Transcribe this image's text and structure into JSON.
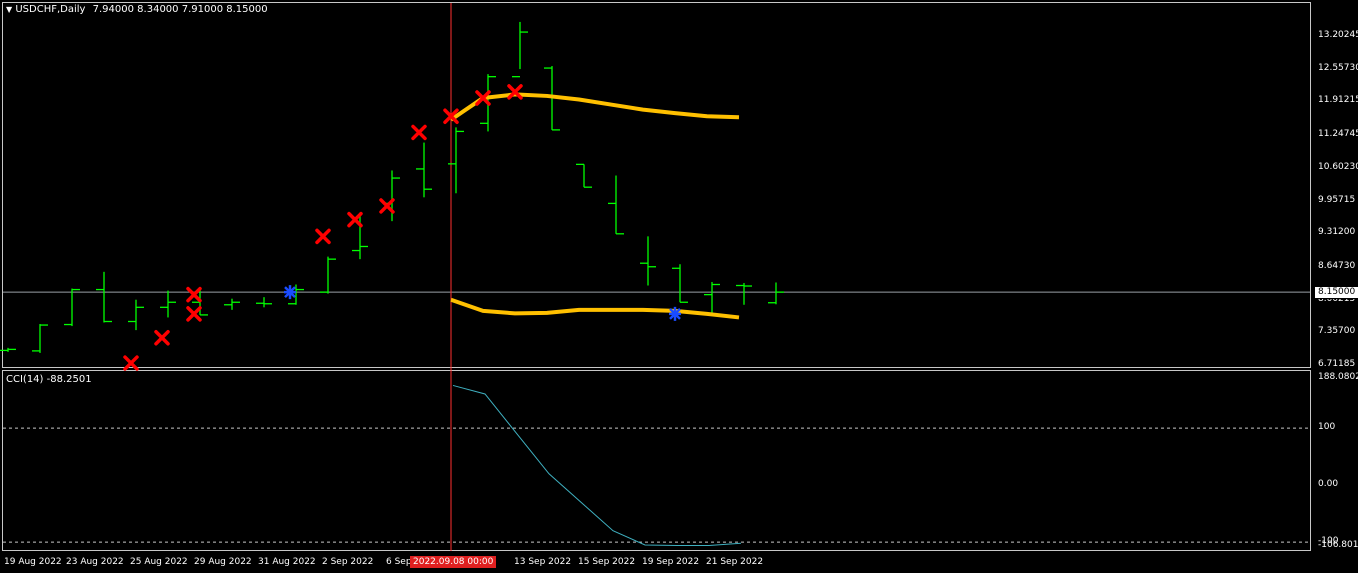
{
  "header": {
    "symbol_label": "USDCHF,Daily",
    "ohlc": "7.94000 8.34000 7.91000 8.15000",
    "menu_icon": "triangle-down-icon"
  },
  "colors": {
    "background": "#000000",
    "bar_up": "#00ff00",
    "ma_line": "#ffc000",
    "signal_sell": "#ff0000",
    "signal_buy": "#1a4cff",
    "cci_line": "#3fb0c0",
    "crosshair": "#ff3030"
  },
  "price_axis": {
    "labels": [
      "13.20245",
      "12.55730",
      "11.91215",
      "11.24745",
      "10.60230",
      "9.95715",
      "9.31200",
      "8.64730",
      "8.00215",
      "7.35700",
      "6.71185"
    ],
    "current_price": "8.15000",
    "range": [
      6.71185,
      13.75
    ]
  },
  "cci": {
    "title": "CCI(14) -88.2501",
    "labels": [
      "188.0802",
      "100",
      "0.00",
      "-100",
      "-106.8011"
    ],
    "range": [
      -106.8011,
      188.0802
    ],
    "levels": [
      100,
      -100
    ],
    "values": [
      175,
      160,
      90,
      20,
      -30,
      -80,
      -105,
      -106,
      -106,
      -102
    ]
  },
  "time_axis": {
    "labels": [
      "19 Aug 2022",
      "23 Aug 2022",
      "25 Aug 2022",
      "29 Aug 2022",
      "31 Aug 2022",
      "2 Sep 2022",
      "6 Sep",
      "13 Sep 2022",
      "15 Sep 2022",
      "19 Sep 2022",
      "21 Sep 2022"
    ],
    "crosshair_label": "2022.09.08 00:00"
  },
  "chart_data": {
    "type": "ohlc",
    "x": [
      "18 Aug",
      "19 Aug",
      "22 Aug",
      "23 Aug",
      "24 Aug",
      "25 Aug",
      "26 Aug",
      "29 Aug",
      "30 Aug",
      "31 Aug",
      "1 Sep",
      "2 Sep",
      "5 Sep",
      "6 Sep",
      "7 Sep",
      "8 Sep",
      "9 Sep",
      "12 Sep",
      "13 Sep",
      "14 Sep",
      "15 Sep",
      "16 Sep",
      "19 Sep",
      "20 Sep",
      "21 Sep",
      "22 Sep",
      "23 Sep"
    ],
    "bars": [
      {
        "o": 7.0,
        "h": 7.05,
        "l": 6.97,
        "c": 7.02
      },
      {
        "o": 6.99,
        "h": 7.52,
        "l": 6.95,
        "c": 7.5
      },
      {
        "o": 7.51,
        "h": 8.22,
        "l": 7.48,
        "c": 8.2
      },
      {
        "o": 8.2,
        "h": 8.55,
        "l": 7.55,
        "c": 7.57
      },
      {
        "o": 7.57,
        "h": 8.0,
        "l": 7.4,
        "c": 7.85
      },
      {
        "o": 7.85,
        "h": 8.18,
        "l": 7.65,
        "c": 7.95
      },
      {
        "o": 7.95,
        "h": 8.2,
        "l": 7.7,
        "c": 7.7
      },
      {
        "o": 7.9,
        "h": 8.02,
        "l": 7.8,
        "c": 7.95
      },
      {
        "o": 7.93,
        "h": 8.05,
        "l": 7.85,
        "c": 7.92
      },
      {
        "o": 7.92,
        "h": 8.3,
        "l": 7.9,
        "c": 8.2
      },
      {
        "o": 8.15,
        "h": 8.85,
        "l": 8.12,
        "c": 8.8
      },
      {
        "o": 8.97,
        "h": 9.72,
        "l": 8.8,
        "c": 9.05
      },
      {
        "o": 9.9,
        "h": 10.55,
        "l": 9.55,
        "c": 10.4
      },
      {
        "o": 10.58,
        "h": 11.1,
        "l": 10.02,
        "c": 10.18
      },
      {
        "o": 10.68,
        "h": 11.4,
        "l": 10.1,
        "c": 11.32
      },
      {
        "o": 11.48,
        "h": 12.45,
        "l": 11.32,
        "c": 12.4
      },
      {
        "o": 12.4,
        "h": 13.48,
        "l": 12.55,
        "c": 13.28
      },
      {
        "o": 12.57,
        "h": 12.61,
        "l": 11.35,
        "c": 11.35
      },
      {
        "o": 10.67,
        "h": 10.67,
        "l": 10.22,
        "c": 10.22
      },
      {
        "o": 9.9,
        "h": 10.45,
        "l": 9.3,
        "c": 9.3
      },
      {
        "o": 8.72,
        "h": 9.25,
        "l": 8.28,
        "c": 8.65
      },
      {
        "o": 8.62,
        "h": 8.7,
        "l": 7.95,
        "c": 7.95
      },
      {
        "o": 8.1,
        "h": 8.35,
        "l": 7.7,
        "c": 8.3
      },
      {
        "o": 8.28,
        "h": 8.33,
        "l": 7.9,
        "c": 8.27
      },
      {
        "o": 7.94,
        "h": 8.34,
        "l": 7.91,
        "c": 8.15
      }
    ],
    "ma_upper": [
      11.55,
      11.98,
      12.05,
      12.02,
      11.95,
      11.85,
      11.75,
      11.68,
      11.62,
      11.6
    ],
    "ma_lower": [
      8.0,
      7.78,
      7.73,
      7.74,
      7.8,
      7.8,
      7.8,
      7.78,
      7.72,
      7.65
    ],
    "sell_markers": [
      6.75,
      7.25,
      7.72,
      8.1,
      9.25,
      9.58,
      9.85,
      11.3,
      11.62,
      11.98,
      12.1
    ],
    "buy_markers": [
      8.15,
      7.72
    ]
  }
}
